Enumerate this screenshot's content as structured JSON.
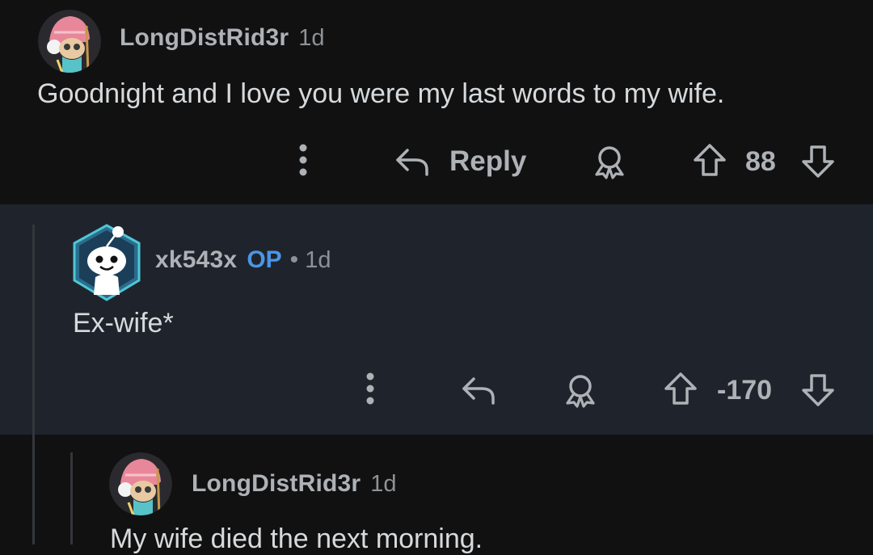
{
  "comments": [
    {
      "username": "LongDistRid3r",
      "time": "1d",
      "text": "Goodnight and I love you were my last words to my wife.",
      "reply_label": "Reply",
      "score": "88"
    },
    {
      "username": "xk543x",
      "op_badge": "OP",
      "separator": "•",
      "time": "1d",
      "text": "Ex-wife*",
      "score": "-170"
    },
    {
      "username": "LongDistRid3r",
      "time": "1d",
      "text": "My wife died the next morning."
    }
  ],
  "colors": {
    "background": "#111112",
    "highlighted_comment": "#1f242c",
    "op_badge": "#4b95e6",
    "muted_text": "#aeb1b5"
  }
}
